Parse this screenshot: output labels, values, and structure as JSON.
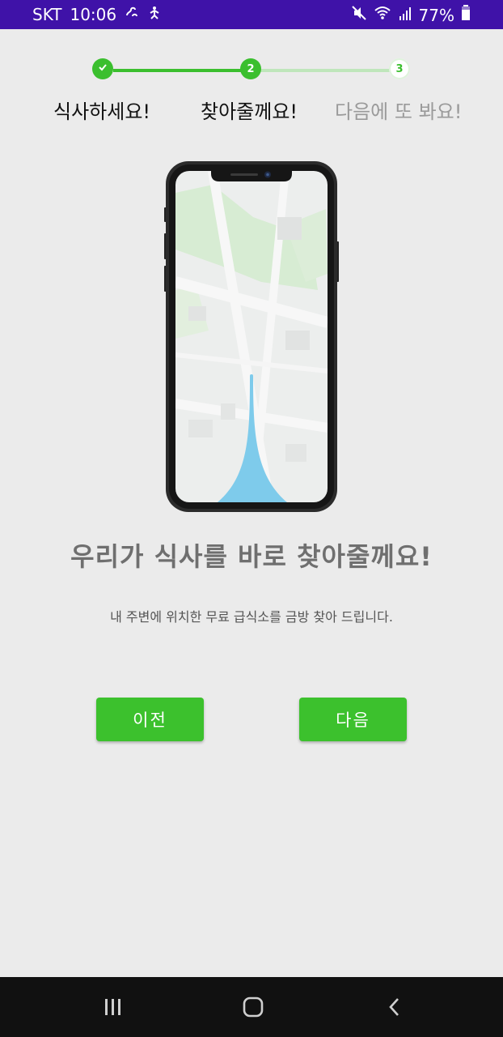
{
  "status_bar": {
    "carrier": "SKT",
    "time": "10:06",
    "battery": "77%",
    "icons": [
      "link-icon",
      "accessibility-icon",
      "mute-icon",
      "wifi-icon",
      "signal-icon",
      "battery-icon"
    ],
    "background": "#3f12a8"
  },
  "stepper": {
    "steps": [
      {
        "index": "",
        "label": "식사하세요!",
        "state": "done"
      },
      {
        "index": "2",
        "label": "찾아줄께요!",
        "state": "current"
      },
      {
        "index": "3",
        "label": "다음에 또 봐요!",
        "state": "upcoming"
      }
    ],
    "accent": "#3bbf2e"
  },
  "main": {
    "headline": "우리가 식사를 바로 찾아줄께요!",
    "subtext": "내 주변에 위치한 무료 급식소를 금방 찾아 드립니다."
  },
  "buttons": {
    "prev_label": "이전",
    "next_label": "다음",
    "color": "#3cc12d"
  },
  "nav_bar": {
    "items": [
      "recent-apps-icon",
      "home-icon",
      "back-icon"
    ]
  }
}
